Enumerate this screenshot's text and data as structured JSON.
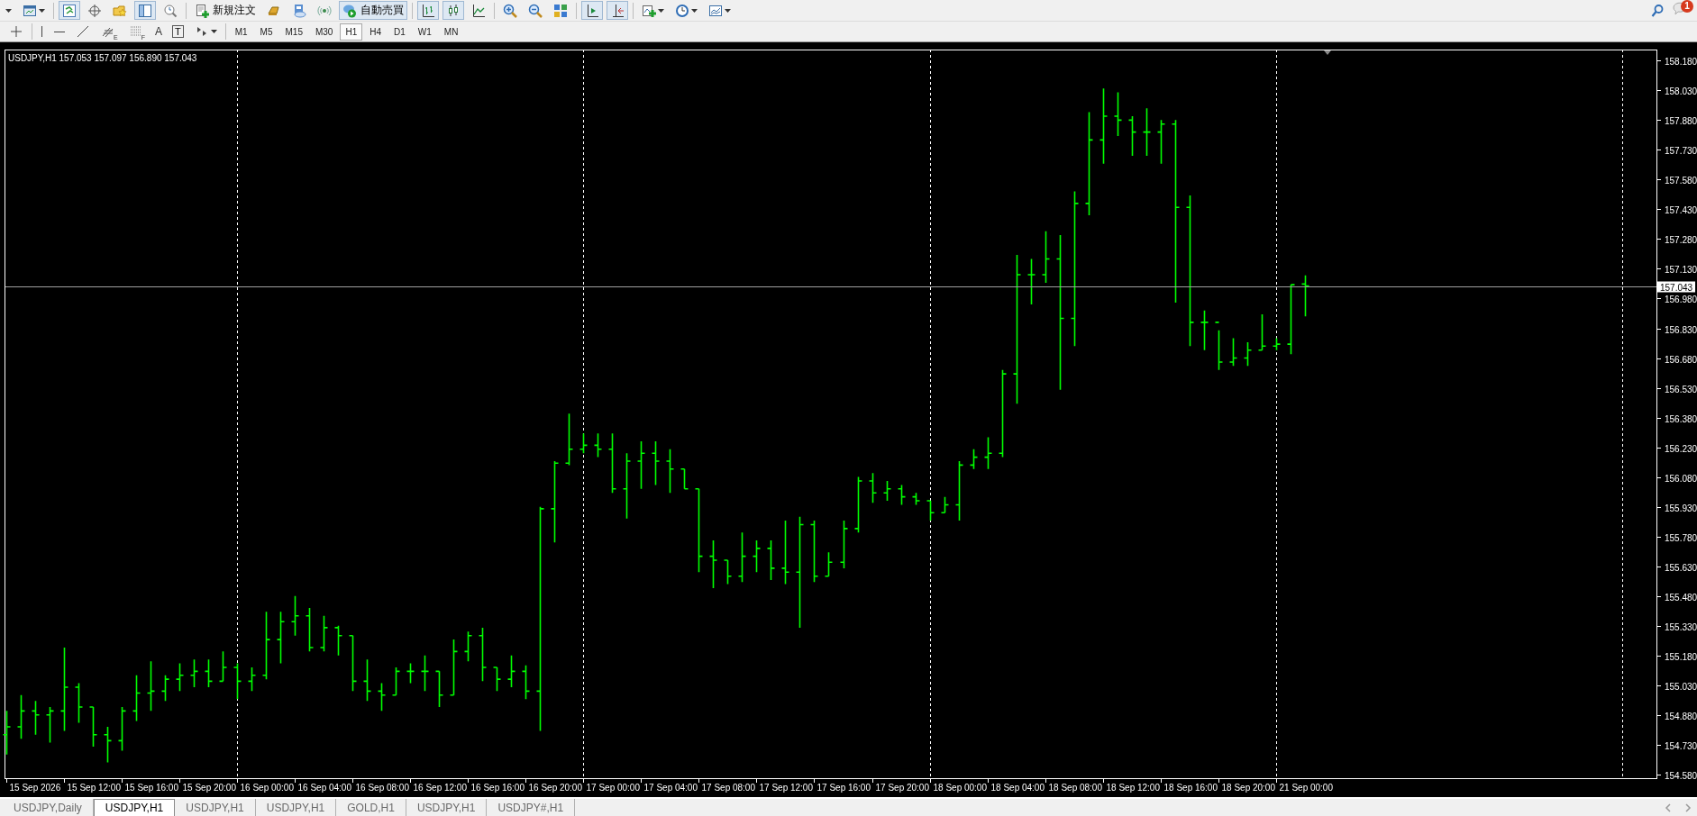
{
  "main_toolbar": {
    "items": [
      {
        "kind": "icon",
        "pressed": false
      },
      {
        "kind": "icon",
        "pressed": false,
        "dropdown": true
      },
      {
        "kind": "separator"
      },
      {
        "kind": "icon",
        "pressed": true
      },
      {
        "kind": "icon",
        "pressed": false
      },
      {
        "kind": "icon",
        "pressed": false
      },
      {
        "kind": "icon",
        "pressed": true
      },
      {
        "kind": "icon",
        "pressed": false
      },
      {
        "kind": "separator"
      },
      {
        "kind": "labeled",
        "label": "新規注文",
        "pressed": false
      },
      {
        "kind": "icon",
        "pressed": false
      },
      {
        "kind": "icon",
        "pressed": false
      },
      {
        "kind": "icon",
        "pressed": false
      },
      {
        "kind": "labeled",
        "label": "自動売買",
        "pressed": true
      },
      {
        "kind": "separator"
      },
      {
        "kind": "icon",
        "pressed": true
      },
      {
        "kind": "icon",
        "pressed": true
      },
      {
        "kind": "icon",
        "pressed": false
      },
      {
        "kind": "separator"
      },
      {
        "kind": "icon",
        "pressed": false
      },
      {
        "kind": "icon",
        "pressed": false
      },
      {
        "kind": "icon",
        "pressed": false
      },
      {
        "kind": "separator"
      },
      {
        "kind": "icon",
        "pressed": true
      },
      {
        "kind": "icon",
        "pressed": true
      },
      {
        "kind": "separator"
      },
      {
        "kind": "icon",
        "pressed": false,
        "dropdown": true
      },
      {
        "kind": "icon",
        "pressed": false,
        "dropdown": true
      },
      {
        "kind": "icon",
        "pressed": false,
        "dropdown": true
      }
    ]
  },
  "top_right": {
    "notification_count": "1"
  },
  "drawing_toolbar": {
    "tools": [
      {
        "kind": "icon"
      },
      {
        "kind": "separator"
      },
      {
        "kind": "icon"
      },
      {
        "kind": "icon"
      },
      {
        "kind": "icon"
      },
      {
        "kind": "icon",
        "letter": "E"
      },
      {
        "kind": "icon",
        "letter": "F"
      },
      {
        "kind": "letter",
        "letter": "A"
      },
      {
        "kind": "boxed-letter",
        "letter": "T"
      },
      {
        "kind": "icon",
        "dropdown": true
      },
      {
        "kind": "separator"
      }
    ],
    "timeframes": [
      {
        "label": "M1",
        "selected": false
      },
      {
        "label": "M5",
        "selected": false
      },
      {
        "label": "M15",
        "selected": false
      },
      {
        "label": "M30",
        "selected": false
      },
      {
        "label": "H1",
        "selected": true
      },
      {
        "label": "H4",
        "selected": false
      },
      {
        "label": "D1",
        "selected": false
      },
      {
        "label": "W1",
        "selected": false
      },
      {
        "label": "MN",
        "selected": false
      }
    ]
  },
  "chart": {
    "title": "USDJPY,H1  157.053 157.097 156.890 157.043",
    "price_labels": [
      "158.180",
      "158.030",
      "157.880",
      "157.730",
      "157.580",
      "157.430",
      "157.280",
      "157.130",
      "156.980",
      "156.830",
      "156.680",
      "156.530",
      "156.380",
      "156.230",
      "156.080",
      "155.930",
      "155.780",
      "155.630",
      "155.480",
      "155.330",
      "155.180",
      "155.030",
      "154.880",
      "154.730",
      "154.580"
    ],
    "current_price": "157.043",
    "time_labels": [
      "15 Sep 2026",
      "15 Sep 12:00",
      "15 Sep 16:00",
      "15 Sep 20:00",
      "16 Sep 00:00",
      "16 Sep 04:00",
      "16 Sep 08:00",
      "16 Sep 12:00",
      "16 Sep 16:00",
      "16 Sep 20:00",
      "17 Sep 00:00",
      "17 Sep 04:00",
      "17 Sep 08:00",
      "17 Sep 12:00",
      "17 Sep 16:00",
      "17 Sep 20:00",
      "18 Sep 00:00",
      "18 Sep 04:00",
      "18 Sep 08:00",
      "18 Sep 12:00",
      "18 Sep 16:00",
      "18 Sep 20:00",
      "21 Sep 00:00"
    ]
  },
  "tabs": [
    {
      "label": "USDJPY,Daily",
      "selected": false
    },
    {
      "label": "USDJPY,H1",
      "selected": true
    },
    {
      "label": "USDJPY,H1",
      "selected": false
    },
    {
      "label": "USDJPY,H1",
      "selected": false
    },
    {
      "label": "GOLD,H1",
      "selected": false
    },
    {
      "label": "USDJPY,H1",
      "selected": false
    },
    {
      "label": "USDJPY#,H1",
      "selected": false
    }
  ]
}
